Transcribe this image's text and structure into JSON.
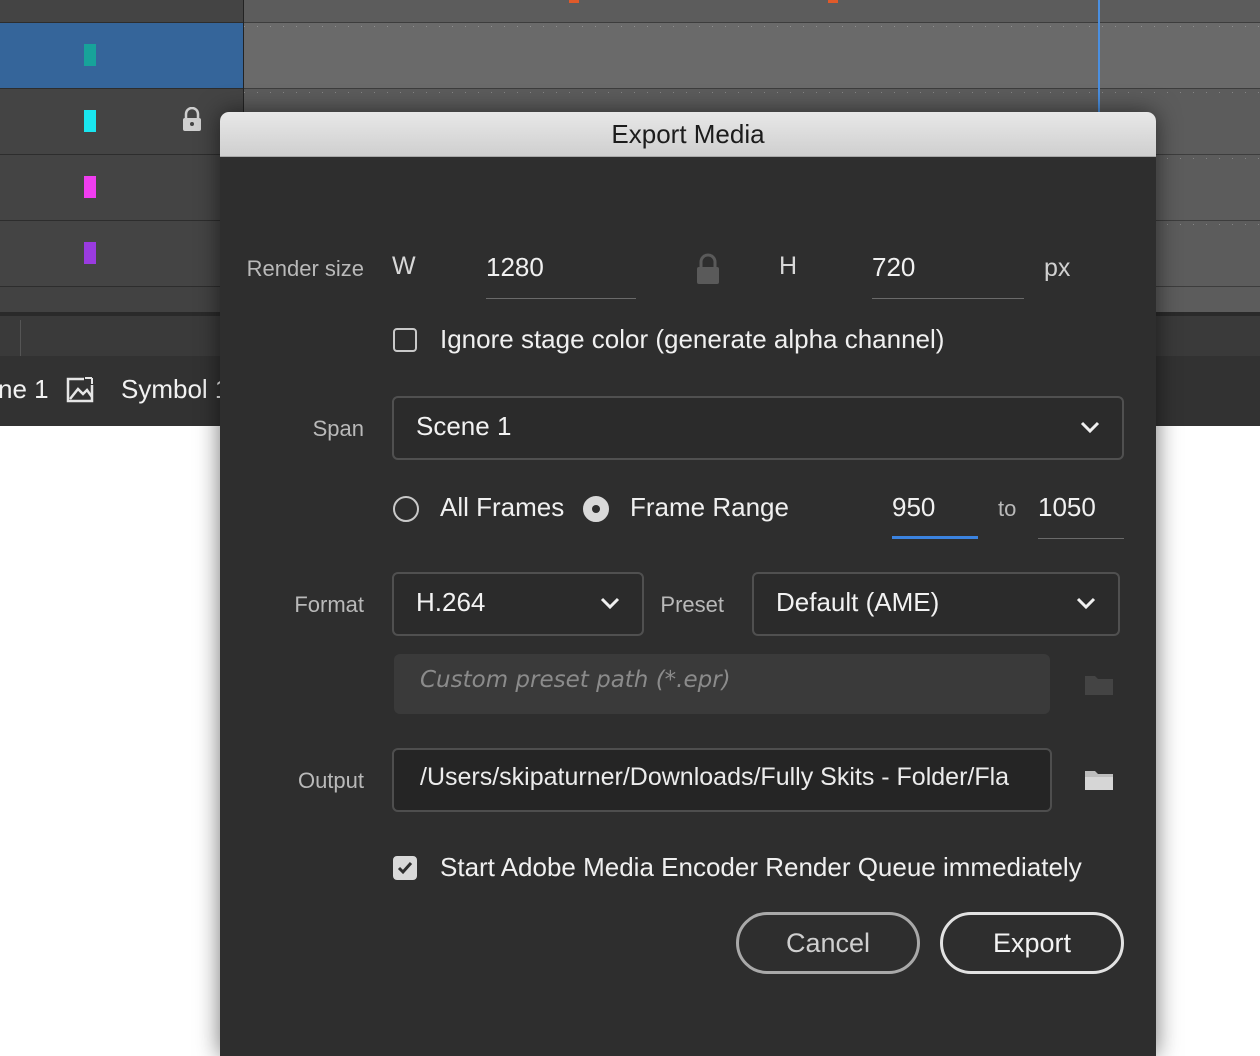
{
  "background": {
    "layers": [
      {
        "color": "#e2752a",
        "locked": true,
        "selected": false
      },
      {
        "color": "#17a39a",
        "locked": false,
        "selected": true
      },
      {
        "color": "#19e6f0",
        "locked": true,
        "selected": false
      },
      {
        "color": "#f03df0",
        "locked": false,
        "selected": false
      },
      {
        "color": "#9a3be0",
        "locked": false,
        "selected": false
      }
    ],
    "breadcrumb": {
      "scene": "ne 1",
      "symbol": "Symbol 1"
    }
  },
  "dialog": {
    "title": "Export Media",
    "render_size": {
      "label": "Render size",
      "w_label": "W",
      "w_value": "1280",
      "h_label": "H",
      "h_value": "720",
      "unit": "px"
    },
    "ignore_stage_color": {
      "label": "Ignore stage color (generate alpha channel)",
      "checked": false
    },
    "span": {
      "label": "Span",
      "value": "Scene 1"
    },
    "frames": {
      "all_frames_label": "All Frames",
      "frame_range_label": "Frame Range",
      "selected": "frame_range",
      "from": "950",
      "to_label": "to",
      "to": "1050"
    },
    "format": {
      "label": "Format",
      "value": "H.264"
    },
    "preset": {
      "label": "Preset",
      "value": "Default (AME)",
      "custom_path_placeholder": "Custom preset path (*.epr)"
    },
    "output": {
      "label": "Output",
      "path": "/Users/skipaturner/Downloads/Fully Skits - Folder/Fla"
    },
    "start_ame": {
      "label": "Start Adobe Media Encoder Render Queue immediately",
      "checked": true
    },
    "buttons": {
      "cancel": "Cancel",
      "export": "Export"
    }
  },
  "colors": {
    "accent": "#3b83e0",
    "dialog_bg": "#2e2e2e",
    "selected_layer": "#35659a"
  }
}
